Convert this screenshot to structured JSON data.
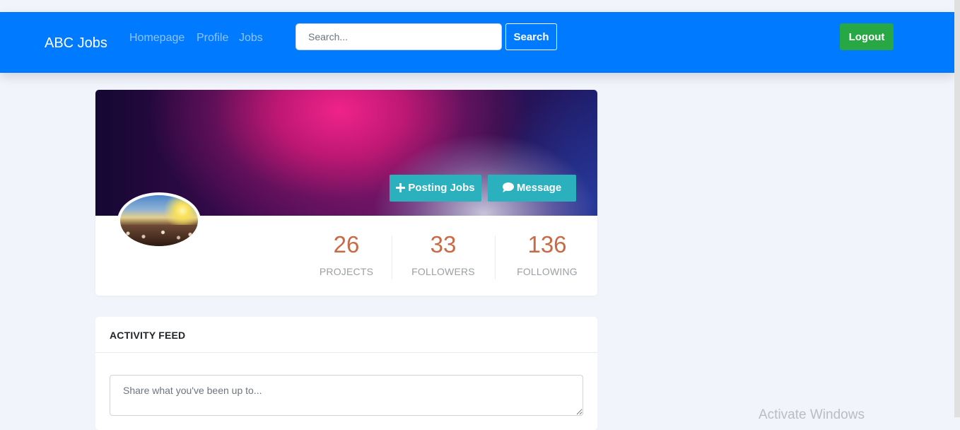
{
  "navbar": {
    "brand": "ABC Jobs",
    "links": [
      "Homepage",
      "Profile",
      "Jobs"
    ],
    "search_placeholder": "Search...",
    "search_label": "Search",
    "logout_label": "Logout",
    "bg_color": "#007bff",
    "logout_color": "#28a745"
  },
  "profile": {
    "actions": [
      {
        "icon": "plus-icon",
        "label": "Posting Jobs"
      },
      {
        "icon": "comment-icon",
        "label": "Message"
      }
    ],
    "action_color": "#2ab1bd",
    "stats": [
      {
        "value": "26",
        "label": "PROJECTS"
      },
      {
        "value": "33",
        "label": "FOLLOWERS"
      },
      {
        "value": "136",
        "label": "FOLLOWING"
      }
    ],
    "stat_value_color": "#c86a45"
  },
  "activity": {
    "title": "ACTIVITY FEED",
    "placeholder": "Share what you've been up to..."
  },
  "os": {
    "watermark": "Activate Windows"
  }
}
